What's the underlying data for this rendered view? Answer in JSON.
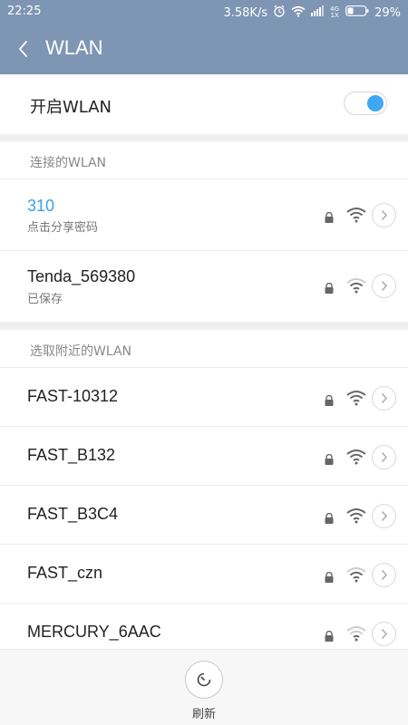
{
  "status": {
    "time": "22:25",
    "speed": "3.58K/s",
    "network_small": "4G 1X",
    "battery": "29%"
  },
  "header": {
    "title": "WLAN"
  },
  "toggle": {
    "label": "开启WLAN",
    "on": true,
    "accent": "#3fa7f6"
  },
  "connected": {
    "header": "连接的WLAN",
    "networks": [
      {
        "ssid": "310",
        "subtitle": "点击分享密码",
        "ssid_color": "#3aa0e8"
      },
      {
        "ssid": "Tenda_569380",
        "subtitle": "已保存"
      }
    ]
  },
  "nearby": {
    "header": "选取附近的WLAN",
    "networks": [
      {
        "ssid": "FAST-10312"
      },
      {
        "ssid": "FAST_B132"
      },
      {
        "ssid": "FAST_B3C4"
      },
      {
        "ssid": "FAST_czn"
      },
      {
        "ssid": "MERCURY_6AAC"
      }
    ]
  },
  "bottom": {
    "refresh_label": "刷新"
  },
  "icons": {
    "lock": "lock-icon",
    "wifi": "wifi-signal-icon",
    "detail": "chevron-right-icon",
    "refresh": "refresh-icon",
    "back": "back-arrow-icon"
  }
}
